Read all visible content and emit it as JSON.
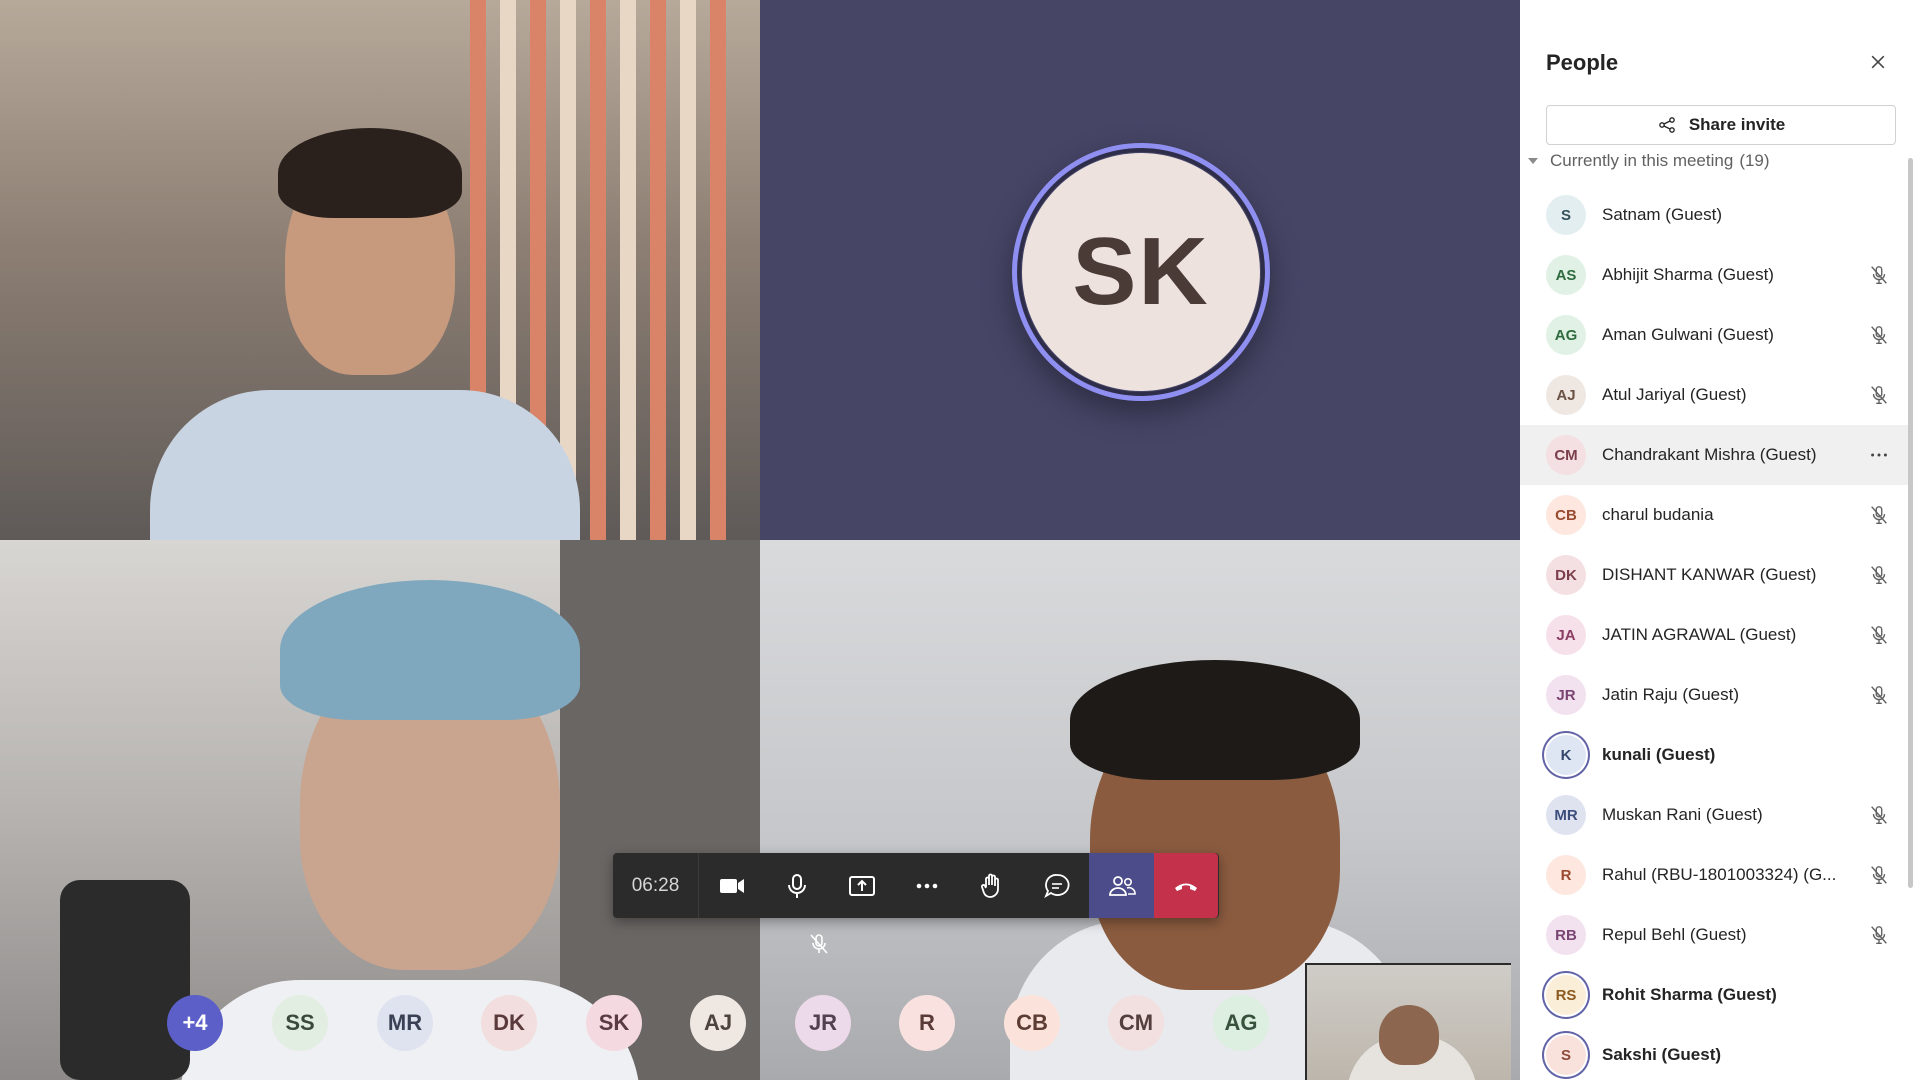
{
  "video_tiles": {
    "speaker_initials": "SK"
  },
  "controls": {
    "timer": "06:28"
  },
  "avatar_strip": [
    {
      "initials": "+4",
      "bg": "#5b5fc7",
      "fg": "#ffffff"
    },
    {
      "initials": "SS",
      "bg": "#e3eee3",
      "fg": "#3a4a3a"
    },
    {
      "initials": "MR",
      "bg": "#dfe3f0",
      "fg": "#3b4154"
    },
    {
      "initials": "DK",
      "bg": "#f2dede",
      "fg": "#5a3a3a"
    },
    {
      "initials": "SK",
      "bg": "#f4d9e0",
      "fg": "#5a3b44"
    },
    {
      "initials": "AJ",
      "bg": "#efe7e2",
      "fg": "#4d433d"
    },
    {
      "initials": "JR",
      "bg": "#ecd9ea",
      "fg": "#52404f"
    },
    {
      "initials": "R",
      "bg": "#f8e1df",
      "fg": "#5a3a36"
    },
    {
      "initials": "CB",
      "bg": "#fbe3dc",
      "fg": "#5c3c33"
    },
    {
      "initials": "CM",
      "bg": "#f2e0e0",
      "fg": "#553e3e"
    },
    {
      "initials": "AG",
      "bg": "#dcefe0",
      "fg": "#37513d"
    }
  ],
  "panel": {
    "title": "People",
    "share_invite": "Share invite",
    "section_label": "Currently in this meeting",
    "section_count": "(19)",
    "participants": [
      {
        "initials": "S",
        "name": "Satnam (Guest)",
        "bg": "#e3eef1",
        "fg": "#35525b",
        "bold": false,
        "trail": "none"
      },
      {
        "initials": "AS",
        "name": "Abhijit Sharma (Guest)",
        "bg": "#e1f1e5",
        "fg": "#2f6b3e",
        "bold": false,
        "trail": "muted-mic"
      },
      {
        "initials": "AG",
        "name": "Aman Gulwani (Guest)",
        "bg": "#e1f1e5",
        "fg": "#2f6b3e",
        "bold": false,
        "trail": "muted-mic"
      },
      {
        "initials": "AJ",
        "name": "Atul Jariyal (Guest)",
        "bg": "#efe7e2",
        "fg": "#6a5244",
        "bold": false,
        "trail": "muted-mic"
      },
      {
        "initials": "CM",
        "name": "Chandrakant Mishra (Guest)",
        "bg": "#f4dfe2",
        "fg": "#7a3f4a",
        "bold": false,
        "trail": "more"
      },
      {
        "initials": "CB",
        "name": "charul budania",
        "bg": "#fde7df",
        "fg": "#9a4a30",
        "bold": false,
        "trail": "muted-mic"
      },
      {
        "initials": "DK",
        "name": "DISHANT KANWAR (Guest)",
        "bg": "#f4dfe2",
        "fg": "#7a3f4a",
        "bold": false,
        "trail": "muted-mic"
      },
      {
        "initials": "JA",
        "name": "JATIN AGRAWAL (Guest)",
        "bg": "#f6e0ea",
        "fg": "#8a3e62",
        "bold": false,
        "trail": "muted-mic"
      },
      {
        "initials": "JR",
        "name": "Jatin Raju (Guest)",
        "bg": "#f2e1ef",
        "fg": "#7a4572",
        "bold": false,
        "trail": "muted-mic"
      },
      {
        "initials": "K",
        "name": "kunali (Guest)",
        "bg": "#dfe6f3",
        "fg": "#34466b",
        "bold": true,
        "trail": "none"
      },
      {
        "initials": "MR",
        "name": "Muskan Rani (Guest)",
        "bg": "#dfe3f0",
        "fg": "#3b4d7a",
        "bold": false,
        "trail": "muted-mic"
      },
      {
        "initials": "R",
        "name": "Rahul (RBU-1801003324) (G...",
        "bg": "#fde7df",
        "fg": "#9a4a30",
        "bold": false,
        "trail": "muted-mic"
      },
      {
        "initials": "RB",
        "name": "Repul Behl (Guest)",
        "bg": "#f2e1ef",
        "fg": "#7a4572",
        "bold": false,
        "trail": "muted-mic"
      },
      {
        "initials": "RS",
        "name": "Rohit Sharma (Guest)",
        "bg": "#fbeed9",
        "fg": "#8a5a1f",
        "bold": true,
        "trail": "none"
      },
      {
        "initials": "S",
        "name": "Sakshi (Guest)",
        "bg": "#f9e2dc",
        "fg": "#8e4a3a",
        "bold": true,
        "trail": "none"
      }
    ]
  },
  "colors": {
    "accent": "#6264a7",
    "leave": "#c4314b",
    "panel_bg": "#ffffff",
    "speaker_tile_bg": "#464566"
  }
}
